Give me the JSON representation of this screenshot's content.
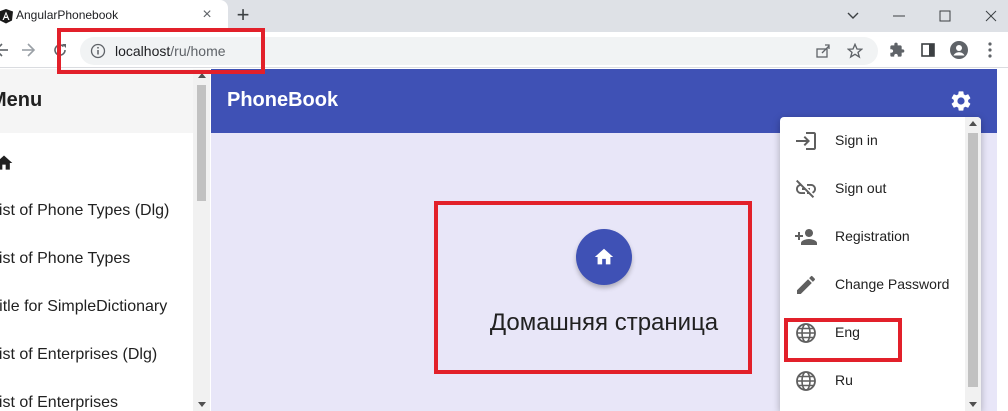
{
  "browser": {
    "tab_title": "AngularPhonebook",
    "tab_close": "×",
    "new_tab": "+",
    "url_host": "localhost",
    "url_path": "/ru/home"
  },
  "sidenav": {
    "title": "Menu",
    "items": [
      {
        "label": "List of Phone Types (Dlg)"
      },
      {
        "label": "List of Phone Types"
      },
      {
        "label": "Title for SimpleDictionary"
      },
      {
        "label": "List of Enterprises (Dlg)"
      },
      {
        "label": "List of Enterprises"
      }
    ]
  },
  "appbar": {
    "brand": "PhoneBook"
  },
  "home": {
    "title": "Домашняя страница"
  },
  "settings_menu": {
    "items": [
      {
        "label": "Sign in",
        "icon": "login-icon"
      },
      {
        "label": "Sign out",
        "icon": "link-off-icon"
      },
      {
        "label": "Registration",
        "icon": "person-add-icon"
      },
      {
        "label": "Change Password",
        "icon": "edit-icon"
      },
      {
        "label": "Eng",
        "icon": "globe-icon"
      },
      {
        "label": "Ru",
        "icon": "globe-icon"
      }
    ]
  },
  "colors": {
    "primary": "#3f51b5",
    "content_bg": "#e8e6f8",
    "highlight": "#e2202a"
  }
}
